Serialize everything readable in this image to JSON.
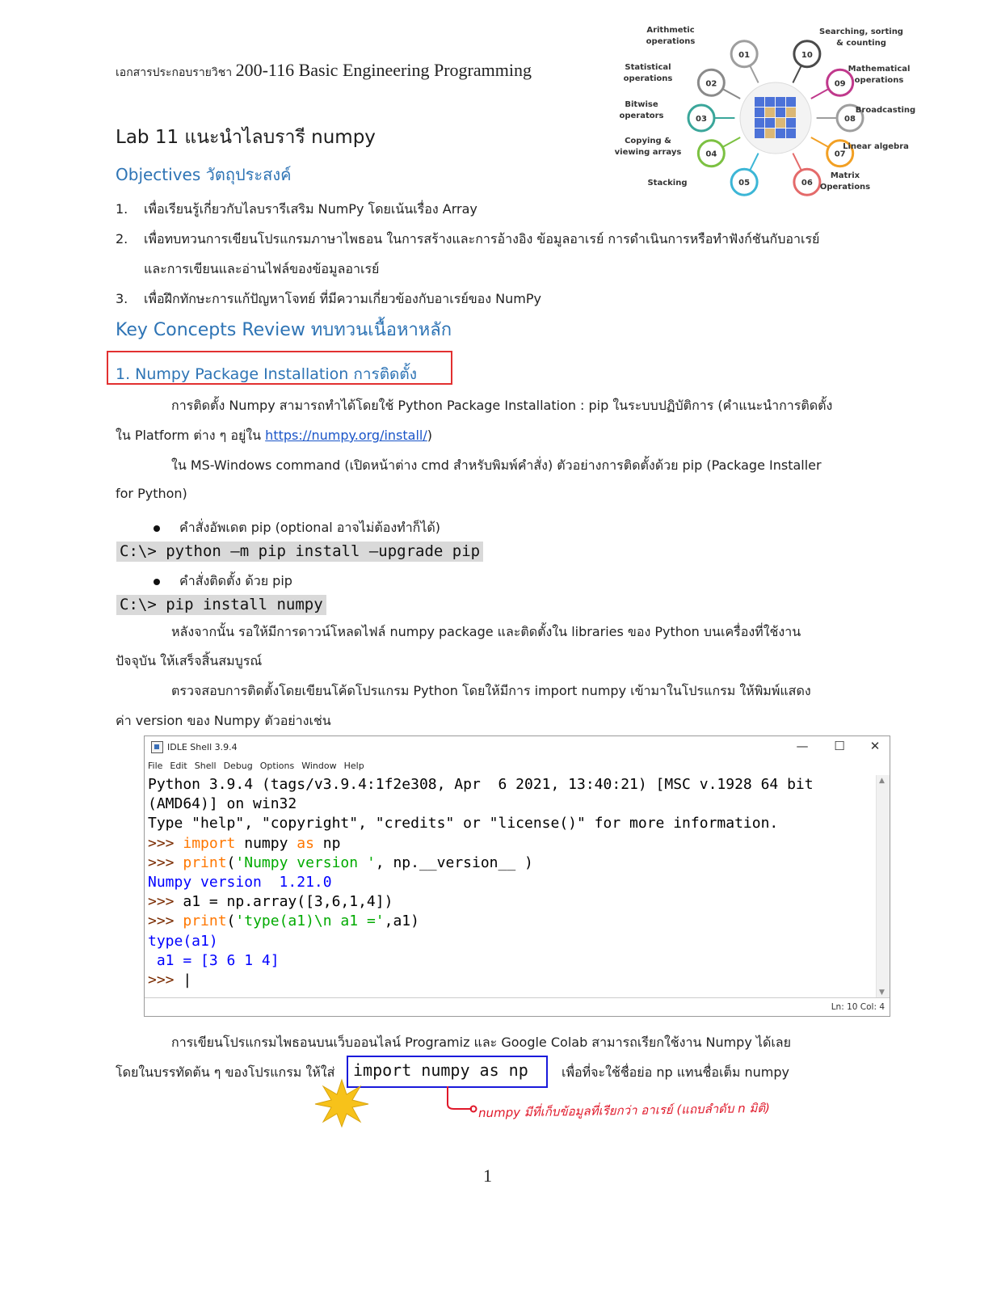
{
  "header": {
    "prefix_thai": "เอกสารประกอบรายวิชา",
    "course": "200-116 Basic Engineering Programming"
  },
  "title": "Lab 11 แนะนำไลบรารี numpy",
  "objectives": {
    "heading": "Objectives วัตถุประสงค์",
    "items": [
      {
        "num": "1.",
        "text": "เพื่อเรียนรู้เกี่ยวกับไลบรารีเสริม NumPy โดยเน้นเรื่อง Array"
      },
      {
        "num": "2.",
        "text": "เพื่อทบทวนการเขียนโปรแกรมภาษาไพธอน ในการสร้างและการอ้างอิง ข้อมูลอาเรย์ การดำเนินการหรือทำฟังก์ชันกับอาเรย์"
      },
      {
        "num": "",
        "text": "และการเขียนและอ่านไฟล์ของข้อมูลอาเรย์"
      },
      {
        "num": "3.",
        "text": "เพื่อฝึกทักษะการแก้ปัญหาโจทย์ ที่มีความเกี่ยวข้องกับอาเรย์ของ NumPy"
      }
    ]
  },
  "key_concepts": "Key Concepts Review ทบทวนเนื้อหาหลัก",
  "section1": {
    "title": "1. Numpy Package Installation การติดตั้ง",
    "p1_line1": "การติดตั้ง Numpy สามารถทำได้โดยใช้ Python Package Installation : pip ในระบบปฏิบัติการ (คำแนะนำการติดตั้ง",
    "p1_line2_pre": "ใน Platform ต่าง ๆ อยู่ใน ",
    "p1_link": "https://numpy.org/install/",
    "p1_line2_post": ")",
    "p2_line1": "ใน  MS-Windows command (เปิดหน้าต่าง cmd สำหรับพิมพ์คำสั่ง) ตัวอย่างการติดตั้งด้วย pip (Package Installer",
    "p2_line2": "for Python)",
    "bullet1": "คำสั่งอัพเดต pip (optional อาจไม่ต้องทำก็ได้)",
    "cmd1": "C:\\> python –m pip install –upgrade pip",
    "bullet2": "คำสั่งติดตั้ง ด้วย pip",
    "cmd2": "C:\\> pip install numpy",
    "p3_line1": "หลังจากนั้น รอให้มีการดาวน์โหลดไฟล์ numpy package และติดตั้งใน libraries ของ Python บนเครื่องที่ใช้งาน",
    "p3_line2": "ปัจจุบัน ให้เสร็จสิ้นสมบูรณ์",
    "p4_line1": "ตรวจสอบการติดตั้งโดยเขียนโค้ดโปรแกรม Python  โดยให้มีการ import numpy เข้ามาในโปรแกรม  ให้พิมพ์แสดง",
    "p4_line2": "ค่า version ของ Numpy  ตัวอย่างเช่น"
  },
  "idle": {
    "title": "IDLE Shell 3.9.4",
    "menu": [
      "File",
      "Edit",
      "Shell",
      "Debug",
      "Options",
      "Window",
      "Help"
    ],
    "btn_min": "—",
    "btn_max": "☐",
    "btn_close": "✕",
    "line1": "Python 3.9.4 (tags/v3.9.4:1f2e308, Apr  6 2021, 13:40:21) [MSC v.1928 64 bit",
    "line2": "(AMD64)] on win32",
    "line3": "Type \"help\", \"copyright\", \"credits\" or \"license()\" for more information.",
    "prompt": ">>> ",
    "l4_kw1": "import",
    "l4_mid": " numpy ",
    "l4_kw2": "as",
    "l4_end": " np",
    "l5_kw": "print",
    "l5_a": "(",
    "l5_str": "'Numpy version '",
    "l5_b": ", np.__version__ )",
    "out1": "Numpy version  1.21.0",
    "l7": "a1 = np.array([3,6,1,4])",
    "l8_kw": "print",
    "l8_a": "(",
    "l8_str": "'type(a1)\\n a1 ='",
    "l8_b": ",a1)",
    "out2": "type(a1)",
    "out3": " a1 = [3 6 1 4]",
    "cursor": "|",
    "status": "Ln: 10  Col: 4"
  },
  "bottom": {
    "p_line1": "การเขียนโปรแกรมไพธอนบนเว็บออนไลน์ Programiz และ Google Colab สามารถเรียกใช้งาน Numpy ได้เลย",
    "p_line2_pre": "โดยในบรรทัดต้น ๆ ของโปรแกรม ให้ใส่",
    "code": "import numpy as np",
    "p_line2_post": "เพื่อที่จะใช้ชื่อย่อ  np แทนชื่อเต็ม numpy",
    "handwritten": "numpy  มีที่เก็บข้อมูลที่เรียกว่า อาเรย์ (แถบลำดับ n มิติ)"
  },
  "diagram": {
    "nodes": [
      {
        "num": "01",
        "label1": "Arithmetic",
        "label2": "operations",
        "color": "#9e9e9e"
      },
      {
        "num": "02",
        "label1": "Statistical",
        "label2": "operations",
        "color": "#8a8a8a"
      },
      {
        "num": "03",
        "label1": "Bitwise",
        "label2": "operators",
        "color": "#3aa69a"
      },
      {
        "num": "04",
        "label1": "Copying &",
        "label2": "viewing arrays",
        "color": "#7cc142"
      },
      {
        "num": "05",
        "label1": "Stacking",
        "label2": "",
        "color": "#3cb6d6"
      },
      {
        "num": "06",
        "label1": "Matrix",
        "label2": "Operations",
        "color": "#e46a6a"
      },
      {
        "num": "07",
        "label1": "Linear algebra",
        "label2": "",
        "color": "#f2a024"
      },
      {
        "num": "08",
        "label1": "Broadcasting",
        "label2": "",
        "color": "#9e9e9e"
      },
      {
        "num": "09",
        "label1": "Mathematical",
        "label2": "operations",
        "color": "#c0398c"
      },
      {
        "num": "10",
        "label1": "Searching, sorting",
        "label2": "& counting",
        "color": "#4a4a4a"
      }
    ]
  },
  "page_number": "1"
}
